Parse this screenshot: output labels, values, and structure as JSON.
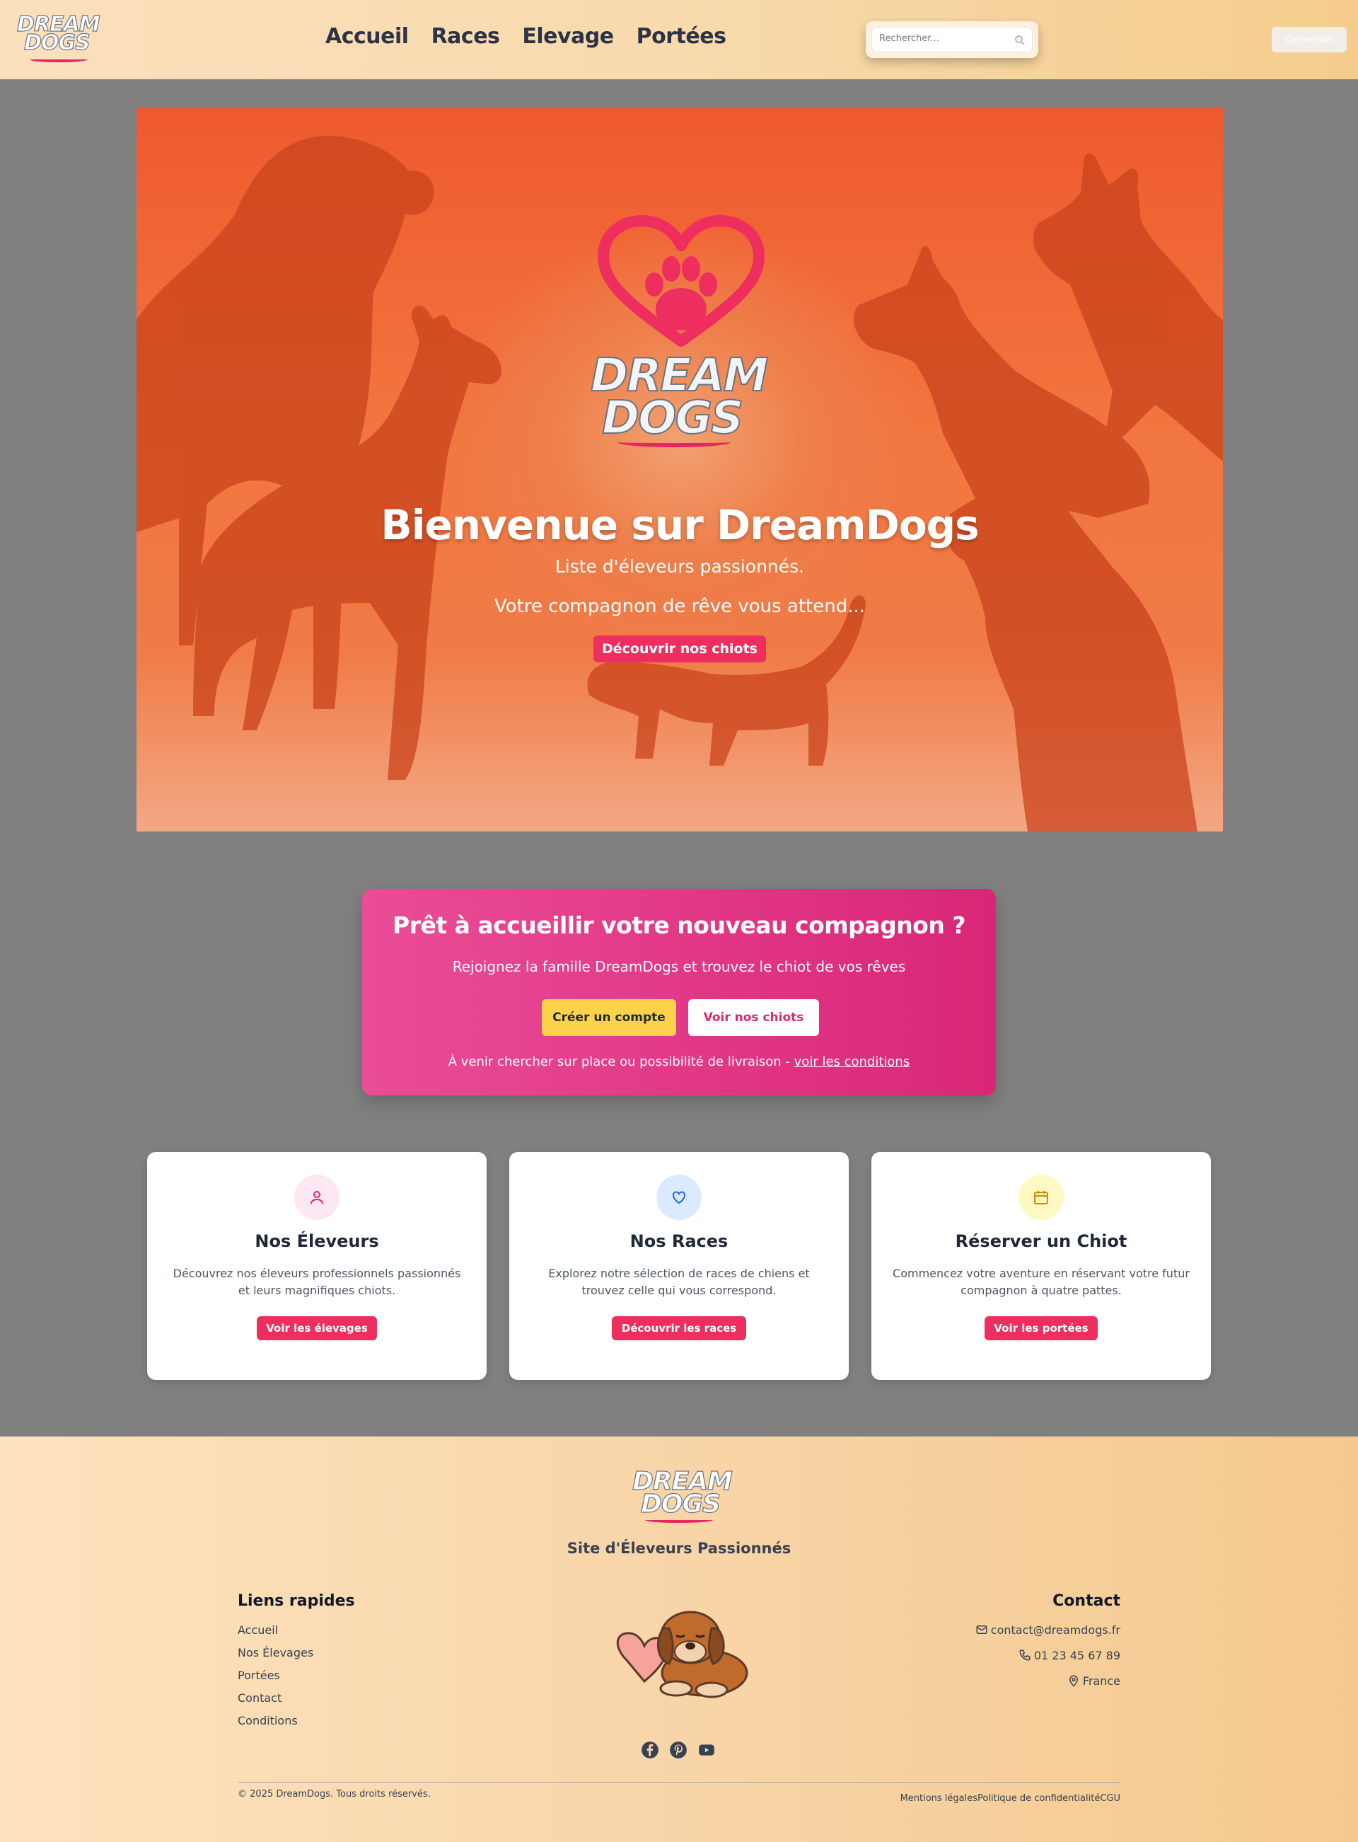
{
  "header": {
    "logo_text_1": "DREAM",
    "logo_text_2": "DOGS",
    "nav": [
      "Accueil",
      "Races",
      "Elevage",
      "Portées"
    ],
    "search_placeholder": "Rechercher...",
    "login_label": "Connexion"
  },
  "hero": {
    "logo_text_1": "DREAM",
    "logo_text_2": "DOGS",
    "title": "Bienvenue sur DreamDogs",
    "subtitle": "Liste d'éleveurs passionnés.",
    "tagline": "Votre compagnon de rêve vous attend...",
    "button": "Découvrir nos chiots"
  },
  "cta": {
    "title": "Prêt à accueillir votre nouveau compagnon ?",
    "subtitle": "Rejoignez la famille DreamDogs et trouvez le chiot de vos rêves",
    "button_primary": "Créer un compte",
    "button_secondary": "Voir nos chiots",
    "note_prefix": "À venir chercher sur place ou possibilité de livraison - ",
    "note_link": "voir les conditions"
  },
  "cards": [
    {
      "icon": "user-icon",
      "title": "Nos Éleveurs",
      "description": "Découvrez nos éleveurs professionnels passionnés et leurs magnifiques chiots.",
      "button": "Voir les élevages"
    },
    {
      "icon": "heart-icon",
      "title": "Nos Races",
      "description": "Explorez notre sélection de races de chiens et trouvez celle qui vous correspond.",
      "button": "Découvrir les races"
    },
    {
      "icon": "calendar-icon",
      "title": "Réserver un Chiot",
      "description": "Commencez votre aventure en réservant votre futur compagnon à quatre pattes.",
      "button": "Voir les portées"
    }
  ],
  "footer": {
    "logo_text_1": "DREAM",
    "logo_text_2": "DOGS",
    "tagline": "Site d'Éleveurs Passionnés",
    "links_title": "Liens rapides",
    "links": [
      "Accueil",
      "Nos Élevages",
      "Portées",
      "Contact",
      "Conditions"
    ],
    "contact_title": "Contact",
    "email": "contact@dreamdogs.fr",
    "phone": "01 23 45 67 89",
    "location": "France",
    "socials": [
      "facebook-icon",
      "pinterest-icon",
      "youtube-icon"
    ],
    "copyright": "© 2025 DreamDogs. Tous droits réservés.",
    "legal": [
      "Mentions légales",
      "Politique de confidentialité",
      "CGU"
    ]
  },
  "colors": {
    "accent_pink": "#ee2e5f",
    "cta_gradient_start": "#ea4c98",
    "cta_gradient_end": "#d92677",
    "cta_yellow": "#fbd24a",
    "header_bg": "#f8d9aa"
  }
}
